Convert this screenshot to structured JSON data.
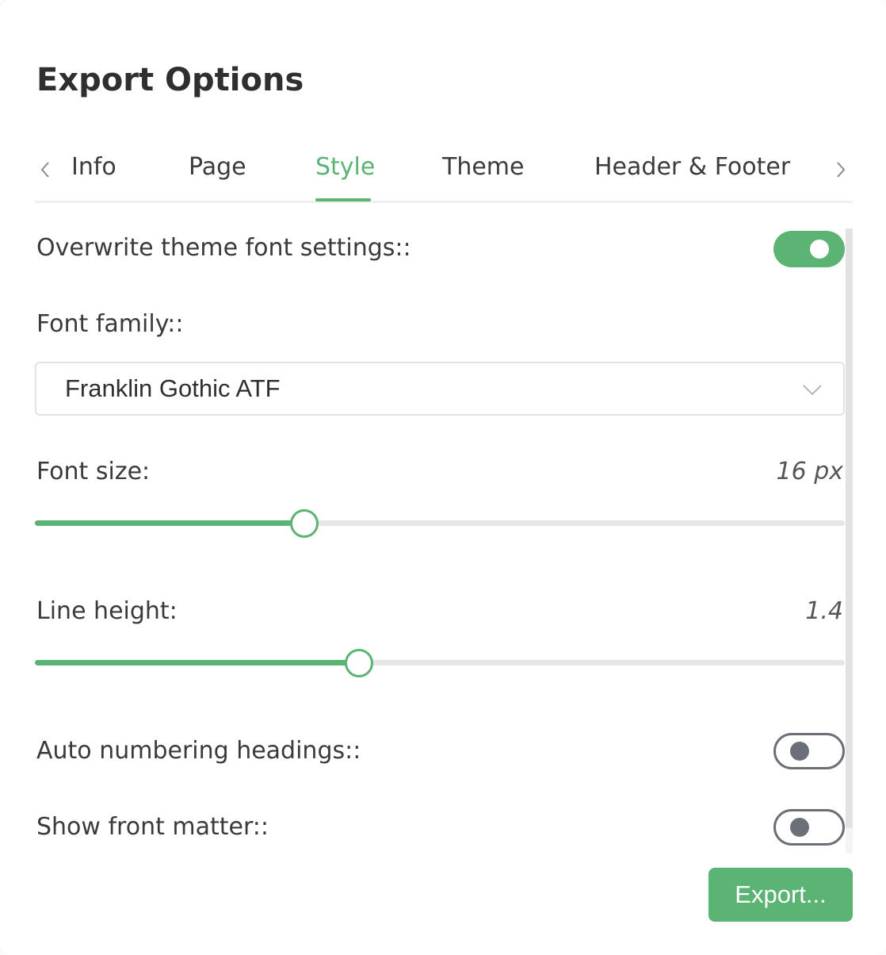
{
  "dialog": {
    "title": "Export Options"
  },
  "tabs": {
    "items": [
      {
        "label": "Info"
      },
      {
        "label": "Page"
      },
      {
        "label": "Style"
      },
      {
        "label": "Theme"
      },
      {
        "label": "Header & Footer"
      }
    ],
    "active": "Style"
  },
  "style": {
    "overwrite_font": {
      "label": "Overwrite theme font settings::",
      "enabled": true
    },
    "font_family": {
      "label": "Font family::",
      "value": "Franklin Gothic ATF"
    },
    "font_size": {
      "label": "Font size:",
      "value_text": "16 px",
      "fraction": 0.333
    },
    "line_height": {
      "label": "Line height:",
      "value_text": "1.4",
      "fraction": 0.4
    },
    "auto_numbering": {
      "label": "Auto numbering headings::",
      "enabled": false
    },
    "front_matter": {
      "label": "Show front matter::",
      "enabled": false
    }
  },
  "actions": {
    "export_label": "Export..."
  },
  "colors": {
    "accent": "#5bb374",
    "toggle_off": "#6b7078",
    "track": "#e6e6e9"
  },
  "icons": {
    "tab_prev": "chevron-left-icon",
    "tab_next": "chevron-right-icon",
    "select": "chevron-down-icon"
  }
}
